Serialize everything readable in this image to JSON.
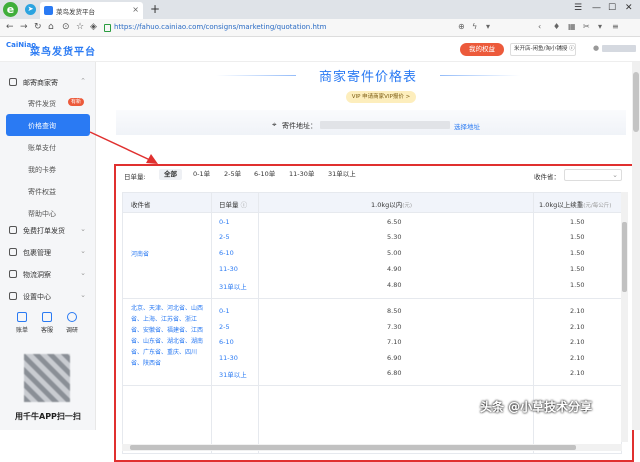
{
  "browser": {
    "tab_title": "菜鸟发货平台",
    "url": "https://fahuo.cainiao.com/consigns/marketing/quotation.htm",
    "new_tab": "+",
    "close_tab": "×"
  },
  "header": {
    "logo_mark": "CaiNiao",
    "logo_text": "菜鸟发货平台",
    "rights_button": "我的权益",
    "store_selector": "米开店-闲鱼/淘小铺授 ⓘ"
  },
  "sidebar": {
    "sections": [
      {
        "label": "邮寄商家寄",
        "icon": "package-icon",
        "expanded": true
      },
      {
        "label": "免费打单发货",
        "icon": "printer-icon",
        "expanded": false
      },
      {
        "label": "包裹管理",
        "icon": "box-icon",
        "expanded": false
      },
      {
        "label": "物流洞察",
        "icon": "insight-icon",
        "expanded": false
      },
      {
        "label": "设置中心",
        "icon": "gear-icon",
        "expanded": false
      }
    ],
    "items": [
      {
        "label": "寄件发货",
        "badge": "有新"
      },
      {
        "label": "价格查询",
        "active": true
      },
      {
        "label": "账单支付"
      },
      {
        "label": "我的卡券"
      },
      {
        "label": "寄件权益"
      },
      {
        "label": "帮助中心"
      }
    ],
    "shortcuts": [
      {
        "label": "账单",
        "icon": "bill-icon"
      },
      {
        "label": "客服",
        "icon": "headset-icon"
      },
      {
        "label": "调研",
        "icon": "clock-icon"
      }
    ],
    "qr_tip": "用千牛APP扫一扫"
  },
  "main": {
    "title": "商家寄件价格表",
    "vip_banner": "VIP 申请商家VIP报价 >",
    "address_label": "寄件地址：",
    "address_link": "选择地址",
    "filter": {
      "label": "日单量:",
      "options": [
        "全部",
        "0-1单",
        "2-5单",
        "6-10单",
        "11-30单",
        "31单以上"
      ],
      "selected": 0
    },
    "province_label": "收件省：",
    "table": {
      "headers": {
        "province": "收件省",
        "daily": "日单量",
        "first": "1.0kg以内",
        "first_unit": "(元)",
        "extra": "1.0kg以上续重",
        "extra_unit": "(元/每公斤)"
      },
      "groups": [
        {
          "province": "河南省",
          "rows": [
            {
              "tier": "0-1",
              "first": "6.50",
              "extra": "1.50"
            },
            {
              "tier": "2-5",
              "first": "5.30",
              "extra": "1.50"
            },
            {
              "tier": "6-10",
              "first": "5.00",
              "extra": "1.50"
            },
            {
              "tier": "11-30",
              "first": "4.90",
              "extra": "1.50"
            },
            {
              "tier": "31单以上",
              "first": "4.80",
              "extra": "1.50"
            }
          ]
        },
        {
          "province": "北京、天津、河北省、山西省、上海、江苏省、浙江省、安徽省、福建省、江西省、山东省、湖北省、湖南省、广东省、重庆、四川省、陕西省",
          "rows": [
            {
              "tier": "0-1",
              "first": "8.50",
              "extra": "2.10"
            },
            {
              "tier": "2-5",
              "first": "7.30",
              "extra": "2.10"
            },
            {
              "tier": "6-10",
              "first": "7.10",
              "extra": "2.10"
            },
            {
              "tier": "11-30",
              "first": "6.90",
              "extra": "2.10"
            },
            {
              "tier": "31单以上",
              "first": "6.80",
              "extra": "2.10"
            }
          ]
        }
      ]
    }
  },
  "watermark": "头条 @小草技术分享",
  "colors": {
    "accent": "#2a7af3",
    "highlight": "#e0302f",
    "rights": "#ec5a3b"
  }
}
